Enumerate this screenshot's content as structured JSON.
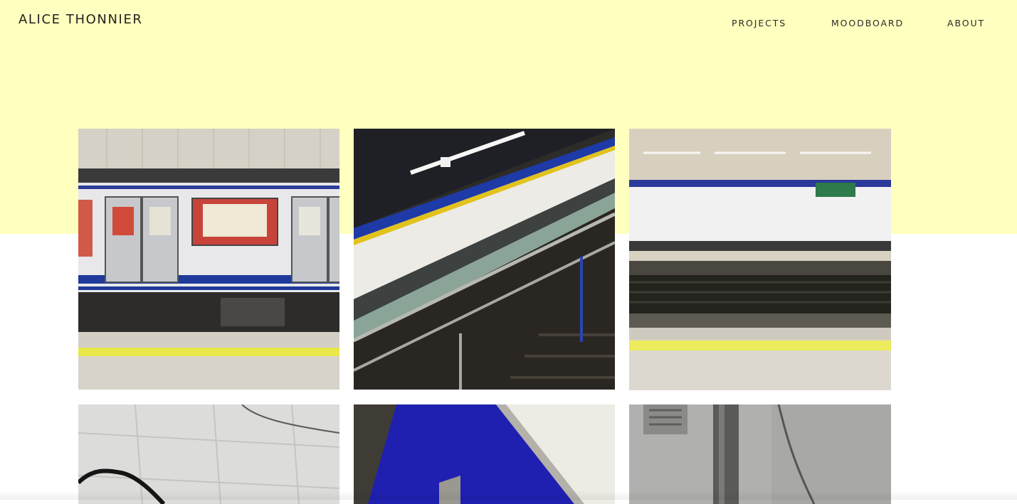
{
  "header": {
    "site_title": "ALICE THONNIER"
  },
  "nav": {
    "items": [
      "PROJECTS",
      "MOODBOARD",
      "ABOUT"
    ]
  },
  "colors": {
    "hero_background": "#ffffbf",
    "page_background": "#ffffff"
  },
  "gallery": {
    "tiles": [
      {
        "subject": "metro-train"
      },
      {
        "subject": "escalator"
      },
      {
        "subject": "station-platform"
      },
      {
        "subject": "cracked-wall"
      },
      {
        "subject": "blue-staircase"
      },
      {
        "subject": "drainpipe"
      }
    ]
  }
}
